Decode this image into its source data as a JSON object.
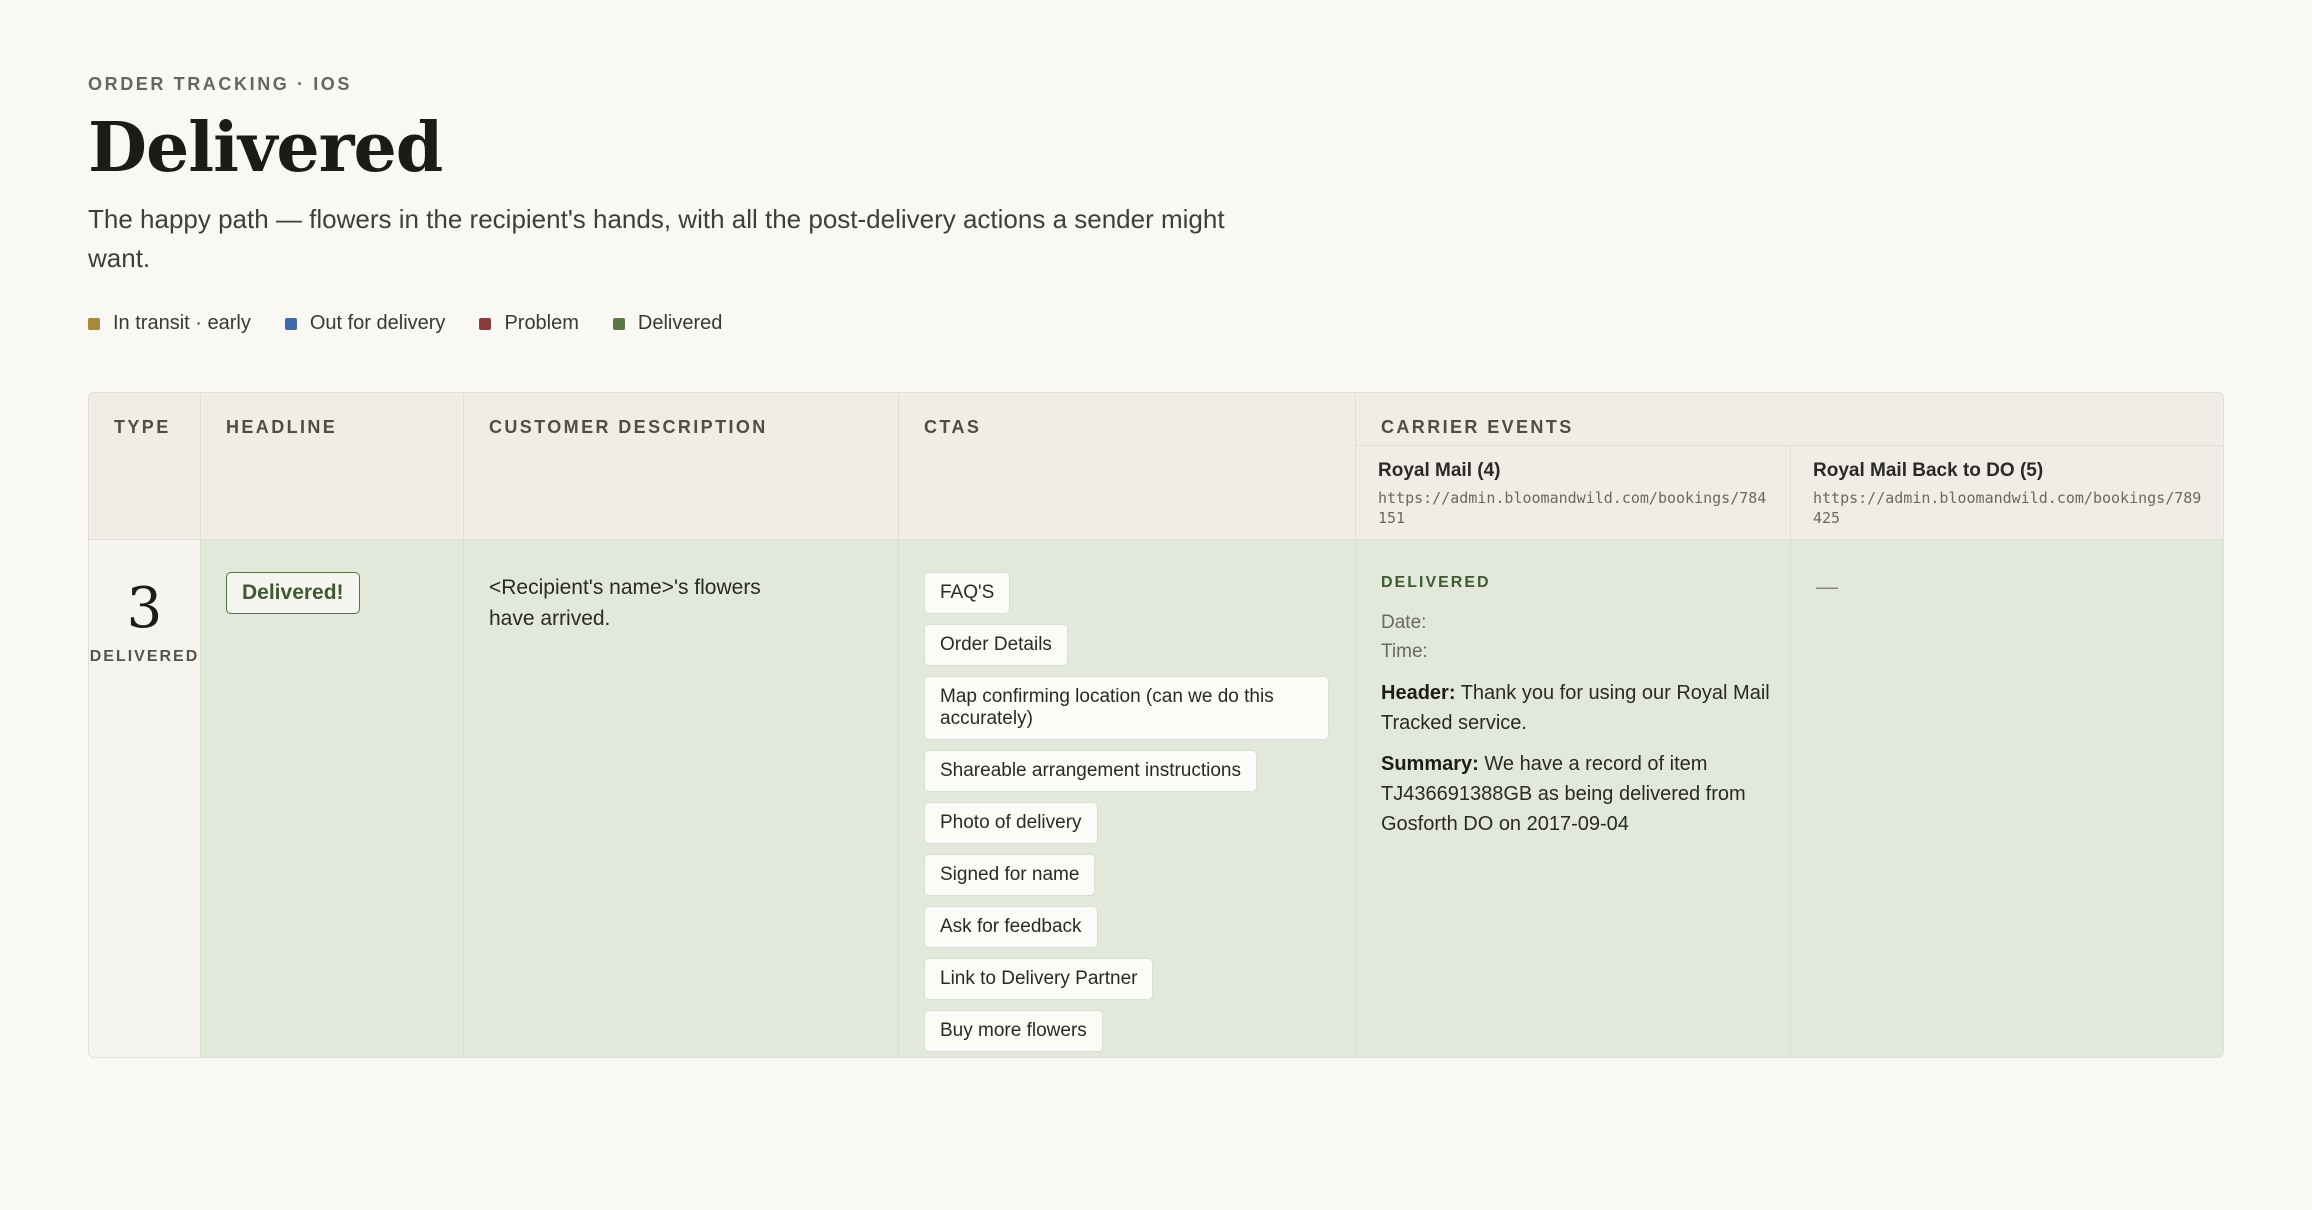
{
  "eyebrow": "ORDER TRACKING · IOS",
  "title": "Delivered",
  "subtitle": "The happy path — flowers in the recipient's hands, with all the post-delivery actions a sender might want.",
  "legend": [
    {
      "label": "In transit · early",
      "color": "#a88a3a"
    },
    {
      "label": "Out for delivery",
      "color": "#3d6aa8"
    },
    {
      "label": "Problem",
      "color": "#8a3c3c"
    },
    {
      "label": "Delivered",
      "color": "#5a7846"
    }
  ],
  "table": {
    "headers": {
      "type": "TYPE",
      "headline": "HEADLINE",
      "description": "CUSTOMER DESCRIPTION",
      "ctas": "CTAS",
      "carrier_events": "CARRIER EVENTS"
    },
    "carriers": [
      {
        "name": "Royal Mail (4)",
        "url": "https://admin.bloomandwild.com/bookings/784151"
      },
      {
        "name": "Royal Mail Back to DO (5)",
        "url": "https://admin.bloomandwild.com/bookings/789425"
      }
    ],
    "row": {
      "type_number": "3",
      "type_label": "DELIVERED",
      "headline": "Delivered!",
      "description": "<Recipient's name>'s flowers have arrived.",
      "ctas": [
        "FAQ'S",
        "Order Details",
        "Map confirming location (can we do this accurately)",
        "Shareable arrangement instructions",
        "Photo of delivery",
        "Signed for name",
        "Ask for feedback",
        "Link to Delivery Partner",
        "Buy more flowers"
      ],
      "event": {
        "status": "DELIVERED",
        "date_label": "Date:",
        "time_label": "Time:",
        "header_label": "Header:",
        "header_text": "Thank you for using our Royal Mail Tracked service.",
        "summary_label": "Summary:",
        "summary_text": "We have a record of item TJ436691388GB as being delivered from Gosforth DO on 2017-09-04"
      },
      "second_event": "—"
    }
  }
}
